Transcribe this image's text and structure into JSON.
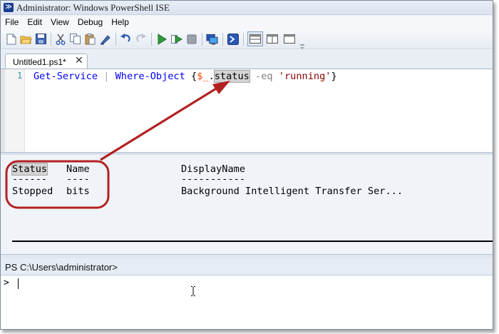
{
  "window": {
    "title": "Administrator: Windows PowerShell ISE",
    "app_icon": "powershell-icon"
  },
  "menu": [
    "File",
    "Edit",
    "View",
    "Debug",
    "Help"
  ],
  "toolbar": {
    "icons": [
      "new-file-icon",
      "open-folder-icon",
      "save-icon",
      "cut-icon",
      "copy-icon",
      "paste-icon",
      "clear-icon",
      "undo-icon",
      "redo-icon",
      "run-icon",
      "run-selection-icon",
      "stop-icon",
      "remote-powershell-icon",
      "powershell-console-icon",
      "layout-top-icon",
      "layout-right-icon",
      "layout-max-icon"
    ]
  },
  "tab": {
    "label": "Untitled1.ps1*",
    "close": "✕"
  },
  "editor": {
    "line_number": "1",
    "tokens": {
      "cmd1": "Get-Service",
      "pipe": "|",
      "cmd2": "Where-Object",
      "brace_open": "{",
      "var": "$_",
      "dot": ".",
      "prop": "status",
      "param": "-eq",
      "str": "'running'",
      "brace_close": "}"
    }
  },
  "output": {
    "headers": [
      "Status",
      "Name",
      "DisplayName"
    ],
    "underlines": [
      "------",
      "----",
      "-----------"
    ],
    "rows": [
      [
        "Stopped",
        "bits",
        "Background Intelligent Transfer Ser..."
      ]
    ]
  },
  "prompt": {
    "text": "PS C:\\Users\\administrator>"
  },
  "console": {
    "prompt": ">"
  },
  "colors": {
    "annotation": "#b22222",
    "keyword": "#0000ff",
    "variable": "#ff4500",
    "string": "#8b0000"
  }
}
